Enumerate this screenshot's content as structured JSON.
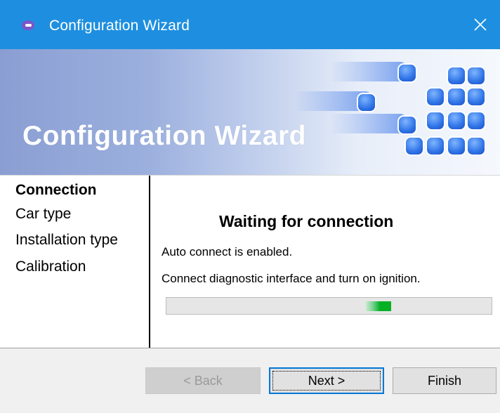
{
  "window": {
    "title": "Configuration Wizard",
    "titlebar_color": "#1e8fe0",
    "icon": "app-icon",
    "close_icon": "close-icon"
  },
  "banner": {
    "title": "Configuration Wizard"
  },
  "steps": [
    {
      "label": "Connection",
      "active": true
    },
    {
      "label": "Car type",
      "active": false
    },
    {
      "label": "Installation type",
      "active": false
    },
    {
      "label": "Calibration",
      "active": false
    }
  ],
  "main": {
    "heading": "Waiting for connection",
    "line1": "Auto connect is enabled.",
    "line2": "Connect diagnostic interface and turn on ignition.",
    "progress": {
      "style": "marquee",
      "color": "#06b025"
    }
  },
  "buttons": {
    "back": "< Back",
    "next": "Next >",
    "finish": "Finish"
  }
}
